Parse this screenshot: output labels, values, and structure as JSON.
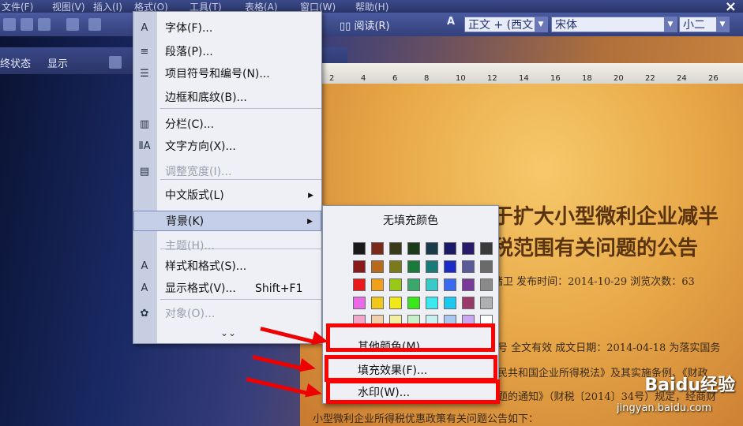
{
  "menubar": {
    "items": [
      "文件(F)",
      "视图(V)",
      "插入(I)",
      "格式(O)",
      "工具(T)",
      "表格(A)",
      "窗口(W)",
      "帮助(H)"
    ]
  },
  "toolbar": {
    "read_label": "阅读(R)",
    "style_value": "正文 + (西文",
    "font_value": "宋体",
    "size_value": "小二",
    "status_label": "终状态",
    "show_label": "显示"
  },
  "ruler": {
    "ticks": [
      "2",
      "4",
      "6",
      "8",
      "10",
      "12",
      "14",
      "16",
      "18",
      "20",
      "22",
      "24",
      "26"
    ]
  },
  "format_menu": {
    "items": [
      {
        "label": "字体(F)...",
        "icon": "A"
      },
      {
        "label": "段落(P)...",
        "icon": "≡"
      },
      {
        "label": "项目符号和编号(N)...",
        "icon": "☰"
      },
      {
        "label": "边框和底纹(B)...",
        "icon": ""
      },
      {
        "label": "分栏(C)...",
        "icon": "▥"
      },
      {
        "label": "文字方向(X)...",
        "icon": "ⅡA"
      },
      {
        "label": "调整宽度(I)...",
        "icon": "▤"
      },
      {
        "label": "中文版式(L)",
        "icon": ""
      },
      {
        "label": "背景(K)",
        "icon": ""
      },
      {
        "label": "主题(H)...",
        "icon": ""
      },
      {
        "label": "样式和格式(S)...",
        "icon": "A"
      },
      {
        "label": "显示格式(V)...",
        "icon": "A",
        "shortcut": "Shift+F1"
      },
      {
        "label": "对象(O)...",
        "icon": "✿"
      }
    ]
  },
  "background_menu": {
    "no_fill": "无填充颜色",
    "other_colors": "其他颜色(M)...",
    "fill_effects": "填充效果(F)...",
    "watermark": "水印(W)..."
  },
  "palette": [
    [
      "#1a1a1a",
      "#7a2a1a",
      "#3a3a1a",
      "#1a3a1a",
      "#1a3a4a",
      "#1a1a6a",
      "#2a1a6a",
      "#3a3a3a"
    ],
    [
      "#8a1a1a",
      "#b86a1a",
      "#7a7a1a",
      "#1a7a3a",
      "#1a7a7a",
      "#1a2ac8",
      "#5a5a9a",
      "#6a6a6a"
    ],
    [
      "#e81a1a",
      "#f0a01a",
      "#9ac81a",
      "#3aa86a",
      "#3ac8c8",
      "#3a6af0",
      "#7a3a9a",
      "#8a8a8a"
    ],
    [
      "#e86ae8",
      "#f0c81a",
      "#f0e81a",
      "#3ae81a",
      "#3ae8f0",
      "#1ac8f0",
      "#9a3a6a",
      "#b0b0b0"
    ],
    [
      "#f0a8c8",
      "#f0d0a8",
      "#f0f0a0",
      "#c8f0c8",
      "#c8f0f0",
      "#a8c8f0",
      "#c8a8f0",
      "#ffffff"
    ]
  ],
  "document": {
    "title_line1": "于扩大小型微利企业减半",
    "title_line2": "税范围有关问题的公告",
    "meta": "绪卫 发布时间：2014-10-29 浏览次数：63",
    "line1": "号 全文有效 成文日期：2014-04-18 为落实国务",
    "line2": "民共和国企业所得税法》及其实施条例、《财政",
    "line3": "题的通知》（财税〔2014〕34号）规定，经商财",
    "line4": "小型微利企业所得税优惠政策有关问题公告如下："
  },
  "watermark": {
    "logo_text": "Baidu经验",
    "url": "jingyan.baidu.com"
  }
}
